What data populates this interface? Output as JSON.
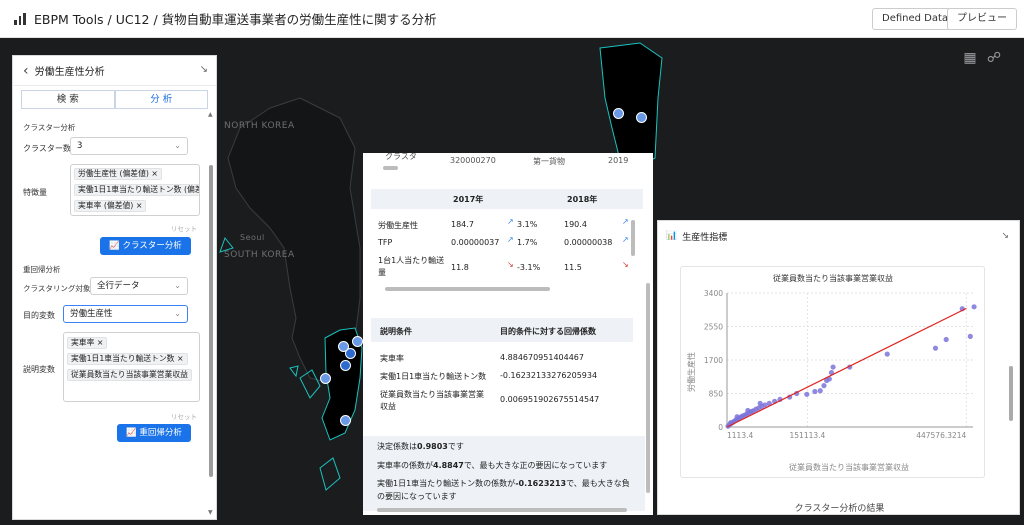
{
  "app": {
    "title": "EBPM Tools / UC12 / 貨物自動車運送事業者の労働生産性に関する分析",
    "defined_data_label": "Defined Data",
    "preview_label": "プレビュー"
  },
  "map": {
    "labels": [
      "NORTH KOREA",
      "SOUTH KOREA",
      "Seoul"
    ],
    "accent_color": "#19c3c0",
    "dot_color": "#6a9ae6"
  },
  "left_panel": {
    "title": "労働生産性分析",
    "tabs": [
      {
        "label": "検 索"
      },
      {
        "label": "分 析"
      }
    ],
    "cluster": {
      "section_label": "クラスター分析",
      "count_label": "クラスター数",
      "count_value": "3",
      "features_label": "特徴量",
      "features": [
        "労働生産性 (偏差値)",
        "実働1日1車当たり輸送トン数 (偏差",
        "実車率 (偏差値)"
      ],
      "reset": "リセット",
      "button": "クラスター分析"
    },
    "regression": {
      "section_label": "重回帰分析",
      "target_scope_label": "クラスタリング対象",
      "target_scope_value": "全行データ",
      "objective_label": "目的変数",
      "objective_value": "労働生産性",
      "explanatory_label": "説明変数",
      "explanatory": [
        "実車率",
        "実働1日1車当たり輸送トン数",
        "従業員数当たり当該事業営業収益"
      ],
      "reset": "リセット",
      "button": "重回帰分析"
    }
  },
  "middle_panel": {
    "cluster_row": {
      "col1": "クラスタ",
      "col2": "320000270",
      "col3": "第一貨物",
      "col4": "2019"
    },
    "years": [
      "2017年",
      "2018年"
    ],
    "metrics": [
      {
        "label": "労働生産性",
        "v2017": "184.7",
        "c2017": "3.1%",
        "t2017": "up",
        "v2018": "190.4"
      },
      {
        "label": "TFP",
        "v2017": "0.00000037",
        "c2017": "1.7%",
        "t2017": "up",
        "v2018": "0.00000038"
      },
      {
        "label": "1台1人当たり輸送量",
        "v2017": "11.8",
        "c2017": "-3.1%",
        "t2017": "down",
        "v2018": "11.5"
      }
    ],
    "regression_table": {
      "headers": [
        "説明条件",
        "目的条件に対する回帰係数"
      ],
      "rows": [
        {
          "label": "実車率",
          "value": "4.884670951404467"
        },
        {
          "label": "実働1日1車当たり輸送トン数",
          "value": "-0.16232133276205934"
        },
        {
          "label": "従業員数当たり当該事業営業収益",
          "value": "0.006951902675514547"
        }
      ]
    },
    "summary": {
      "r2_prefix": "決定係数は",
      "r2_value": "0.9803",
      "r2_suffix": "です",
      "line1_prefix": "実車率の係数が",
      "line1_value": "4.8847",
      "line1_suffix": "で、最も大きな正の要因になっています",
      "line2_prefix": "実働1日1車当たり輸送トン数の係数が",
      "line2_value": "-0.1623213",
      "line2_suffix": "で、最も大きな負",
      "line3": "の要因になっています"
    }
  },
  "right_panel": {
    "title": "生産性指標",
    "bottom_label": "クラスター分析の結果"
  },
  "chart_data": {
    "type": "scatter",
    "title": "従業員数当たり当該事業営業収益",
    "xlabel": "従業員数当たり当該事業営業収益",
    "ylabel": "労働生産性",
    "x_ticks": [
      "1113.4",
      "151113.4",
      "447576.3214"
    ],
    "y_ticks": [
      "0",
      "850",
      "1700",
      "2550",
      "3400"
    ],
    "xlim": [
      1113.4,
      460000
    ],
    "ylim": [
      0,
      3400
    ],
    "grid": true,
    "point_color": "#7b74d9",
    "trend_color": "#e0231f",
    "points": [
      [
        3000,
        20
      ],
      [
        6000,
        60
      ],
      [
        9000,
        90
      ],
      [
        12000,
        120
      ],
      [
        15000,
        150
      ],
      [
        18000,
        180
      ],
      [
        21000,
        200
      ],
      [
        24000,
        230
      ],
      [
        27000,
        250
      ],
      [
        30000,
        280
      ],
      [
        34000,
        300
      ],
      [
        38000,
        330
      ],
      [
        42000,
        360
      ],
      [
        46000,
        390
      ],
      [
        50000,
        410
      ],
      [
        55000,
        450
      ],
      [
        60000,
        480
      ],
      [
        66000,
        520
      ],
      [
        72000,
        560
      ],
      [
        80000,
        600
      ],
      [
        90000,
        650
      ],
      [
        100000,
        700
      ],
      [
        118000,
        760
      ],
      [
        131000,
        850
      ],
      [
        150000,
        830
      ],
      [
        165000,
        900
      ],
      [
        175000,
        920
      ],
      [
        182000,
        1050
      ],
      [
        187000,
        1180
      ],
      [
        192000,
        1220
      ],
      [
        196000,
        1380
      ],
      [
        199000,
        1520
      ],
      [
        230000,
        1520
      ],
      [
        300000,
        1850
      ],
      [
        390000,
        2000
      ],
      [
        410000,
        2220
      ],
      [
        440000,
        3000
      ],
      [
        455000,
        2300
      ],
      [
        462000,
        3050
      ],
      [
        8000,
        110
      ],
      [
        20000,
        260
      ],
      [
        40000,
        420
      ],
      [
        63000,
        600
      ]
    ],
    "trend": [
      [
        1113.4,
        0
      ],
      [
        447576.3214,
        3010
      ]
    ]
  }
}
